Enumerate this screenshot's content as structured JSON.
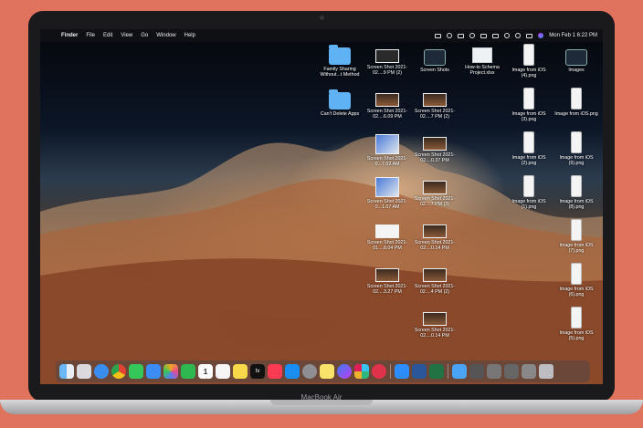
{
  "menubar": {
    "items": [
      "Finder",
      "File",
      "Edit",
      "View",
      "Go",
      "Window",
      "Help"
    ],
    "clock": "Mon Feb 1   6:22 PM"
  },
  "desktop_items": [
    {
      "label": "Family Sharing Without...t Method",
      "kind": "folder"
    },
    {
      "label": "Screen Shot 2021-02....9 PM (2)",
      "kind": "shot"
    },
    {
      "label": "Screen Shots",
      "kind": "folder-dark"
    },
    {
      "label": "How-to Schema Project.xlsx",
      "kind": "doc"
    },
    {
      "label": "Image from iOS (4).png",
      "kind": "phone"
    },
    {
      "label": "Images",
      "kind": "folder-dark"
    },
    {
      "label": "Can't Delete Apps",
      "kind": "folder"
    },
    {
      "label": "Screen Shot 2021-02....6.09 PM",
      "kind": "shot"
    },
    {
      "label": "Screen Shot 2021-02....7 PM (2)",
      "kind": "shot"
    },
    {
      "label": "Image from iOS (3).png",
      "kind": "phone"
    },
    {
      "label": "Image from iOS.png",
      "kind": "phone"
    },
    {
      "label": "Screen Shot 2021-0...7.02 AM",
      "kind": "bigshot"
    },
    {
      "label": "Screen Shot 2021-02....0.37 PM",
      "kind": "shot"
    },
    {
      "label": "Image from iOS (2).png",
      "kind": "phone"
    },
    {
      "label": "Image from iOS (9).png",
      "kind": "phone"
    },
    {
      "label": "Screen Shot 2021-0...1.07 AM",
      "kind": "bigshot"
    },
    {
      "label": "Screen Shot 2021-02....7 PM (3)",
      "kind": "shot"
    },
    {
      "label": "Image from iOS (1).png",
      "kind": "phone"
    },
    {
      "label": "Image from iOS (8).png",
      "kind": "phone"
    },
    {
      "label": "Screen Shot 2021-01....8.04 PM",
      "kind": "shot-white"
    },
    {
      "label": "Screen Shot 2021-02....0.14 PM",
      "kind": "shot"
    },
    {
      "label": "Image from iOS (7).png",
      "kind": "phone"
    },
    {
      "label": "Screen Shot 2021-02....3.27 PM",
      "kind": "shot"
    },
    {
      "label": "Screen Shot 2021-02....4 PM (2)",
      "kind": "shot"
    },
    {
      "label": "Image from iOS (6).png",
      "kind": "phone"
    },
    {
      "label": "Screen Shot 2021-02....0.14 PM",
      "kind": "shot"
    },
    {
      "label": "Image from iOS (5).png",
      "kind": "phone"
    }
  ],
  "dock": {
    "apps": [
      "finder-icon",
      "launchpad-icon",
      "safari-icon",
      "chrome-icon",
      "messages-icon",
      "mail-icon",
      "photos-icon",
      "facetime-icon",
      "calendar-icon",
      "reminders-icon",
      "notes-icon",
      "appletv-icon",
      "music-icon",
      "appstore-icon",
      "settings-icon",
      "sticky-icon",
      "messenger-icon",
      "slack-icon",
      "lips-icon",
      "zoom-icon",
      "word-icon",
      "excel-icon"
    ],
    "calendar_day": "1",
    "tv_label": "tv",
    "right_items": [
      "downloads-icon",
      "recent-1-icon",
      "recent-2-icon",
      "recent-3-icon",
      "recent-4-icon",
      "trash-icon"
    ]
  },
  "laptop": {
    "brand": "MacBook Air"
  }
}
